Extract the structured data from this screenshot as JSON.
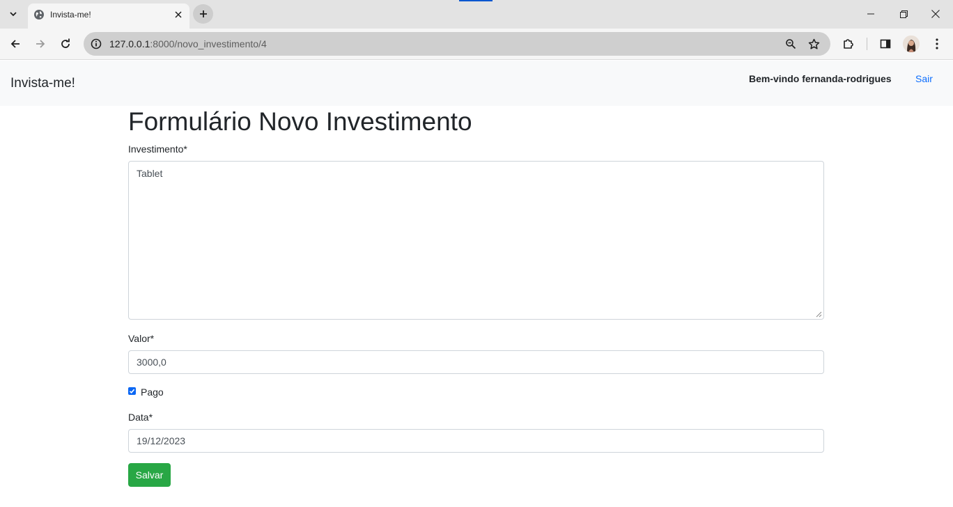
{
  "browser": {
    "tab": {
      "title": "Invista-me!"
    },
    "address": {
      "host": "127.0.0.1",
      "path": ":8000/novo_investimento/4"
    }
  },
  "navbar": {
    "brand": "Invista-me!",
    "welcome": "Bem-vindo fernanda-rodrigues",
    "logout": "Sair"
  },
  "form": {
    "title": "Formulário Novo Investimento",
    "investimento": {
      "label": "Investimento*",
      "value": "Tablet"
    },
    "valor": {
      "label": "Valor*",
      "value": "3000,0"
    },
    "pago": {
      "label": "Pago",
      "checked": true
    },
    "data": {
      "label": "Data*",
      "value": "19/12/2023"
    },
    "save_label": "Salvar"
  },
  "colors": {
    "primary": "#0d6efd",
    "success": "#28a745",
    "navbar_bg": "#f8f9fa"
  }
}
